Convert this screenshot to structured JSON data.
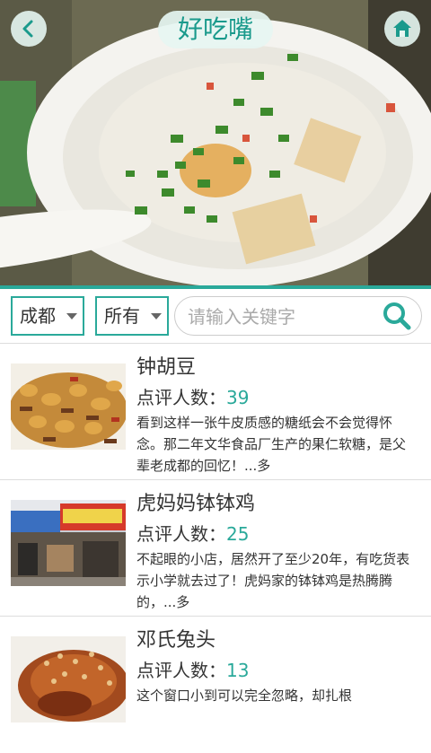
{
  "header": {
    "title": "好吃嘴",
    "back_icon": "chevron-left-icon",
    "home_icon": "home-icon"
  },
  "filters": {
    "city": "成都",
    "category": "所有",
    "search_placeholder": "请输入关键字"
  },
  "list_items": [
    {
      "title": "钟胡豆",
      "count_label": "点评人数：",
      "count": "39",
      "desc": "看到这样一张牛皮质感的糖纸会不会觉得怀念。那二年文华食品厂生产的果仁软糖，是父辈老成都的回忆！...多"
    },
    {
      "title": "虎妈妈钵钵鸡",
      "count_label": "点评人数：",
      "count": "25",
      "desc": "不起眼的小店，居然开了至少20年，有吃货表示小学就去过了！虎妈家的钵钵鸡是热腾腾的，...多"
    },
    {
      "title": "邓氏兔头",
      "count_label": "点评人数：",
      "count": "13",
      "desc": "这个窗口小到可以完全忽略，却扎根"
    }
  ],
  "colors": {
    "accent": "#2aa99a",
    "text": "#333333"
  }
}
